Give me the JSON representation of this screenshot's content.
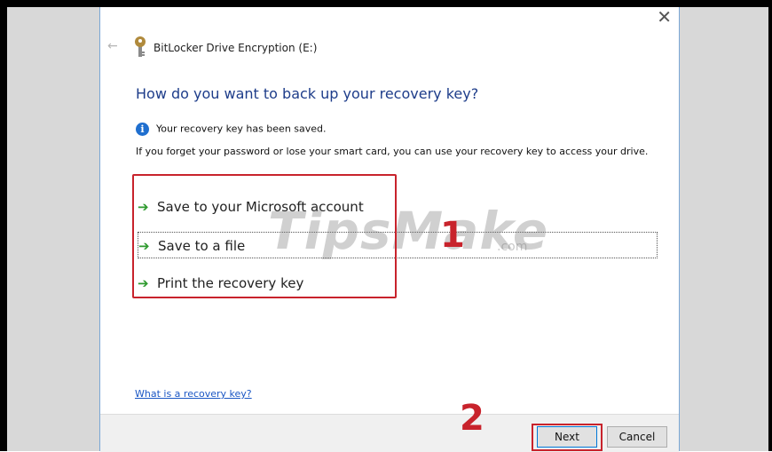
{
  "window": {
    "title": "BitLocker Drive Encryption (E:)",
    "close_glyph": "✕",
    "back_glyph": "←"
  },
  "content": {
    "heading": "How do you want to back up your recovery key?",
    "info_message": "Your recovery key has been saved.",
    "description": "If you forget your password or lose your smart card, you can use your recovery key to access your drive.",
    "options": [
      {
        "label": "Save to your Microsoft account"
      },
      {
        "label": "Save to a file"
      },
      {
        "label": "Print the recovery key"
      }
    ],
    "help_link": "What is a recovery key?"
  },
  "buttons": {
    "next": "Next",
    "cancel": "Cancel"
  },
  "annotations": {
    "step1": "1",
    "step2": "2",
    "watermark": "TipsMake",
    "watermark_suffix": ".com"
  },
  "colors": {
    "annotation_red": "#c8232c",
    "heading_blue": "#1e3d8a",
    "arrow_green": "#2e9a2e"
  }
}
